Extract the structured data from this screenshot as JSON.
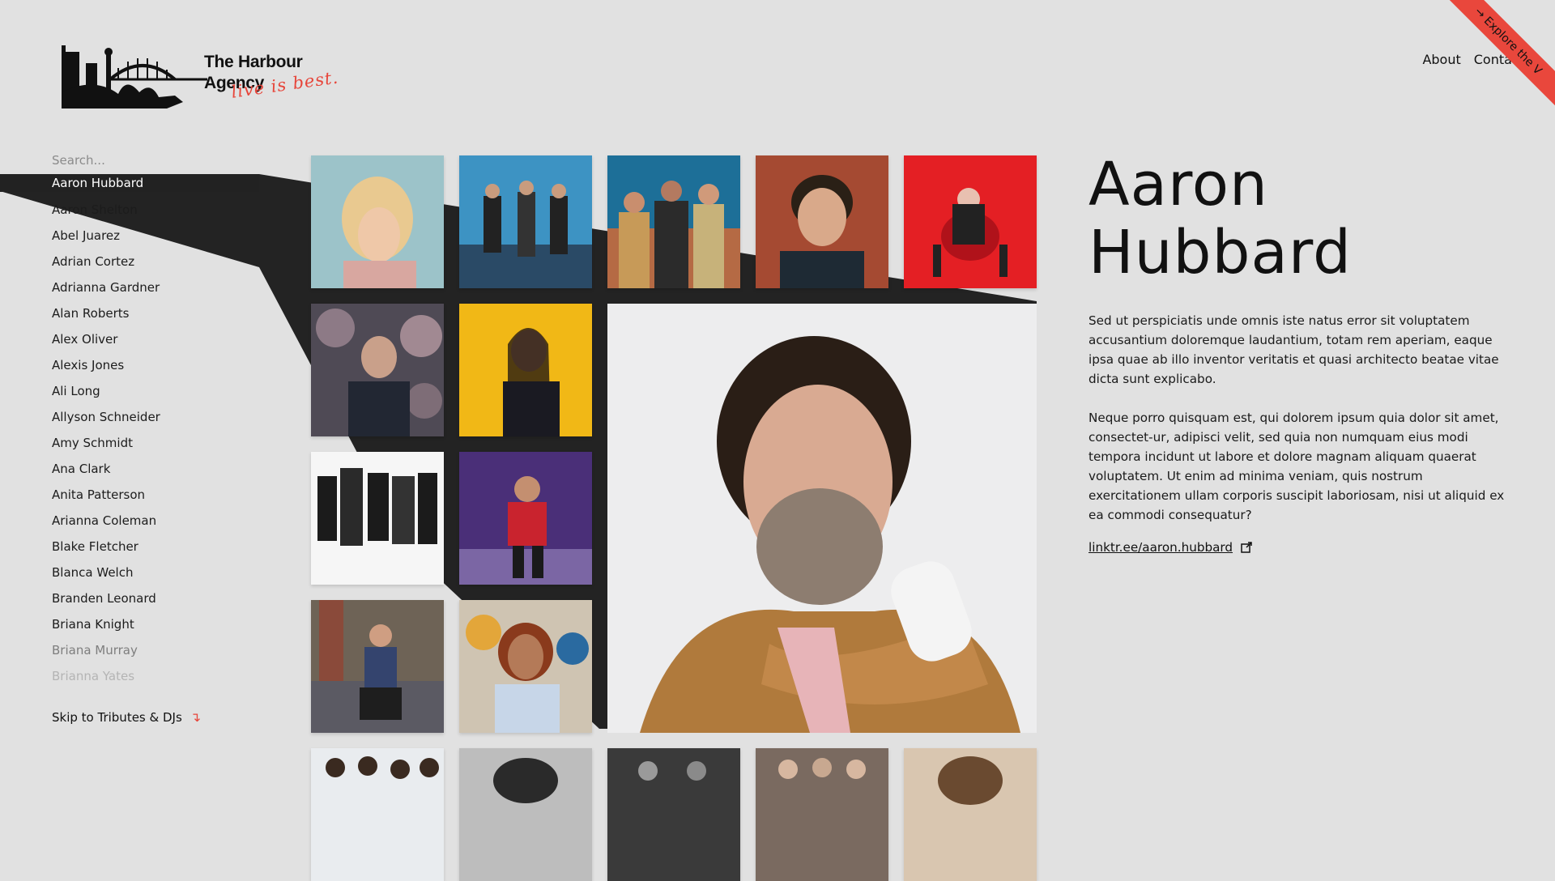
{
  "brand": {
    "title": "The Harbour Agency",
    "tagline": "live is best.",
    "accent": "#e7453a"
  },
  "nav": {
    "about": "About",
    "contact": "Contact"
  },
  "ribbon": {
    "label": "Explore the V",
    "icon": "arrow-right-icon"
  },
  "search": {
    "placeholder": "Search...",
    "value": ""
  },
  "artists": [
    "Aaron Hubbard",
    "Aaron Shelton",
    "Abel Juarez",
    "Adrian Cortez",
    "Adrianna Gardner",
    "Alan Roberts",
    "Alex Oliver",
    "Alexis Jones",
    "Ali Long",
    "Allyson Schneider",
    "Amy Schmidt",
    "Ana Clark",
    "Anita Patterson",
    "Arianna Coleman",
    "Blake Fletcher",
    "Blanca Welch",
    "Branden Leonard",
    "Briana Knight",
    "Briana Murray",
    "Brianna Yates"
  ],
  "skip": {
    "label": "Skip to Tributes & DJs",
    "icon": "arrow-down-right-icon"
  },
  "detail": {
    "first_name": "Aaron",
    "last_name": "Hubbard",
    "bio": [
      "Sed ut perspiciatis unde omnis iste natus error sit voluptatem accusantium doloremque laudantium, totam rem aperiam, eaque ipsa quae ab illo inventor veritatis et quasi architecto beatae vitae dicta sunt explicabo.",
      "Neque porro quisquam est, qui dolorem ipsum quia dolor sit amet, consectet-ur, adipisci velit, sed quia non numquam eius modi tempora incidunt ut labore et dolore magnam aliquam quaerat voluptatem. Ut enim ad minima veniam, quis nostrum exercitationem ullam corporis suscipit laboriosam, nisi ut aliquid ex ea commodi consequatur?"
    ],
    "link": "linktr.ee/aaron.hubbard",
    "link_icon": "external-link-icon"
  }
}
